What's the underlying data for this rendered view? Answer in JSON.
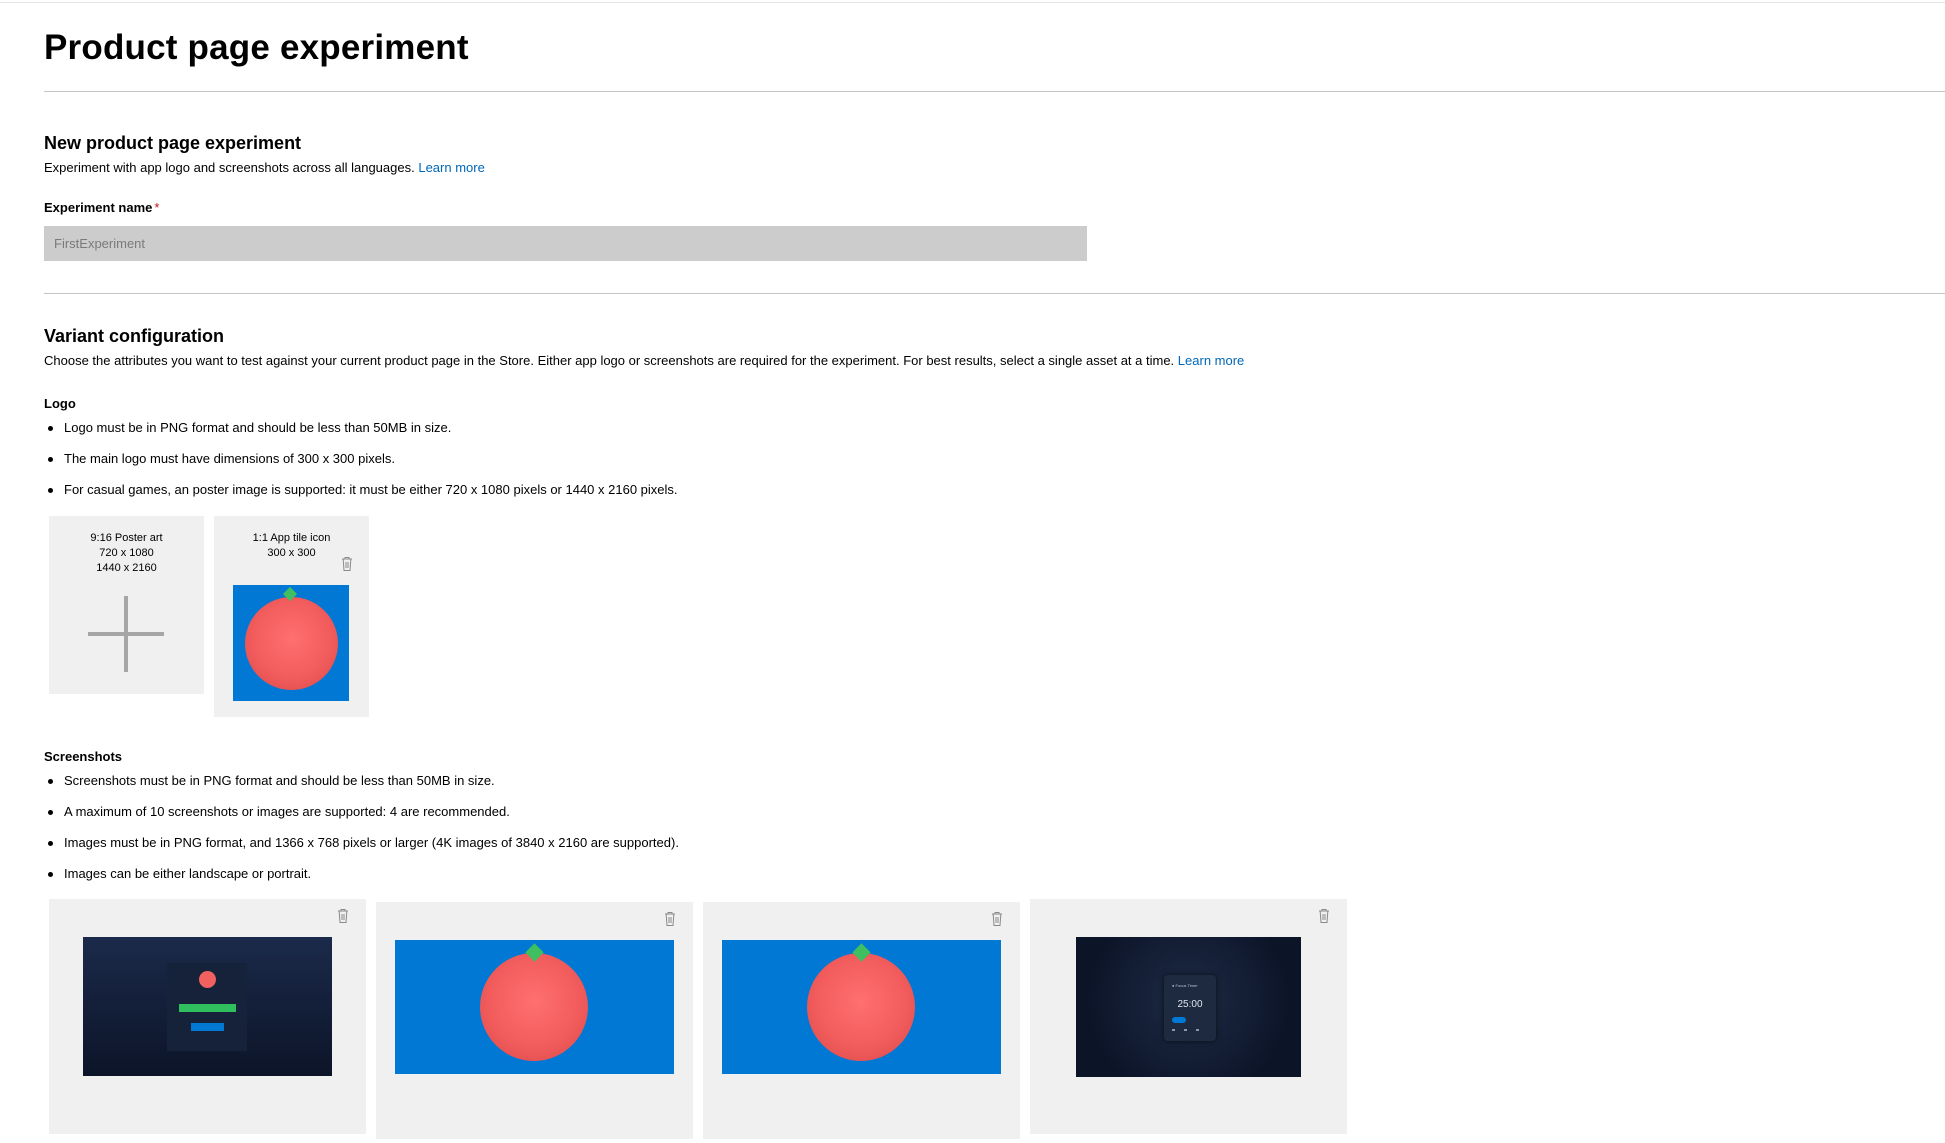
{
  "page": {
    "title": "Product page experiment"
  },
  "new_experiment": {
    "title": "New product page experiment",
    "description": "Experiment with app logo and screenshots across all languages.",
    "learn_more": "Learn more",
    "name_label": "Experiment name",
    "required_mark": "*",
    "name_placeholder": "FirstExperiment"
  },
  "variant": {
    "title": "Variant configuration",
    "description": "Choose the attributes you want to test against your current product page in the Store. Either app logo or screenshots are required for the experiment. For best results, select a single asset at a time.",
    "learn_more": "Learn more"
  },
  "logo": {
    "title": "Logo",
    "bullets": [
      "Logo must be in PNG format and should be less than 50MB in size.",
      "The main logo must have dimensions of 300 x 300 pixels.",
      "For casual games, an poster image is supported: it must be either 720 x 1080 pixels or 1440 x 2160 pixels."
    ],
    "tiles": [
      {
        "caption_1": "9:16 Poster art",
        "caption_2": "720 x 1080",
        "caption_3": "1440 x 2160",
        "icon": "plus-icon"
      },
      {
        "caption_1": "1:1 App tile icon",
        "caption_2": "300 x 300",
        "icon": "trash-icon"
      }
    ]
  },
  "screenshots": {
    "title": "Screenshots",
    "bullets": [
      "Screenshots must be in PNG format and should be less than 50MB in size.",
      "A maximum of 10 screenshots or images are supported: 4 are recommended.",
      "Images must be in PNG format, and 1366 x 768 pixels or larger (4K images of 3840 x 2160 are supported).",
      "Images can be either landscape or portrait."
    ],
    "items": [
      {
        "kind": "dark-app",
        "icon": "trash-icon"
      },
      {
        "kind": "tomato",
        "icon": "trash-icon"
      },
      {
        "kind": "tomato",
        "icon": "trash-icon"
      },
      {
        "kind": "dark-timer",
        "icon": "trash-icon",
        "timer_text": "25:00",
        "app_name": "● Focus Timer"
      }
    ]
  },
  "colors": {
    "link": "#0067b8",
    "required": "#c50f1f",
    "brand_blue": "#0078d4",
    "tomato": "#f25c5c",
    "leaf": "#3fbf5f",
    "tile_bg": "#f0f0f0",
    "input_bg": "#cccccc"
  }
}
